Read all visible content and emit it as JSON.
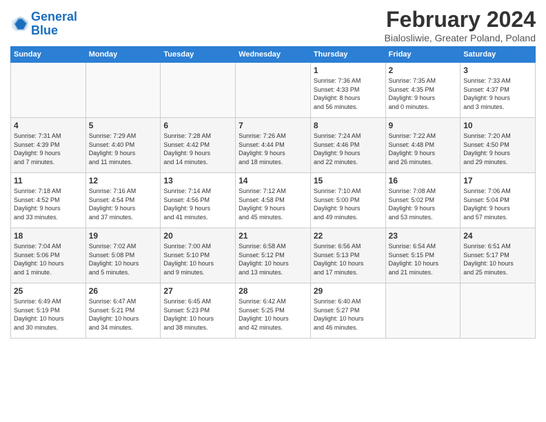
{
  "header": {
    "logo_line1": "General",
    "logo_line2": "Blue",
    "month_year": "February 2024",
    "location": "Bialosliwie, Greater Poland, Poland"
  },
  "days_of_week": [
    "Sunday",
    "Monday",
    "Tuesday",
    "Wednesday",
    "Thursday",
    "Friday",
    "Saturday"
  ],
  "weeks": [
    [
      {
        "day": "",
        "info": ""
      },
      {
        "day": "",
        "info": ""
      },
      {
        "day": "",
        "info": ""
      },
      {
        "day": "",
        "info": ""
      },
      {
        "day": "1",
        "info": "Sunrise: 7:36 AM\nSunset: 4:33 PM\nDaylight: 8 hours\nand 56 minutes."
      },
      {
        "day": "2",
        "info": "Sunrise: 7:35 AM\nSunset: 4:35 PM\nDaylight: 9 hours\nand 0 minutes."
      },
      {
        "day": "3",
        "info": "Sunrise: 7:33 AM\nSunset: 4:37 PM\nDaylight: 9 hours\nand 3 minutes."
      }
    ],
    [
      {
        "day": "4",
        "info": "Sunrise: 7:31 AM\nSunset: 4:39 PM\nDaylight: 9 hours\nand 7 minutes."
      },
      {
        "day": "5",
        "info": "Sunrise: 7:29 AM\nSunset: 4:40 PM\nDaylight: 9 hours\nand 11 minutes."
      },
      {
        "day": "6",
        "info": "Sunrise: 7:28 AM\nSunset: 4:42 PM\nDaylight: 9 hours\nand 14 minutes."
      },
      {
        "day": "7",
        "info": "Sunrise: 7:26 AM\nSunset: 4:44 PM\nDaylight: 9 hours\nand 18 minutes."
      },
      {
        "day": "8",
        "info": "Sunrise: 7:24 AM\nSunset: 4:46 PM\nDaylight: 9 hours\nand 22 minutes."
      },
      {
        "day": "9",
        "info": "Sunrise: 7:22 AM\nSunset: 4:48 PM\nDaylight: 9 hours\nand 26 minutes."
      },
      {
        "day": "10",
        "info": "Sunrise: 7:20 AM\nSunset: 4:50 PM\nDaylight: 9 hours\nand 29 minutes."
      }
    ],
    [
      {
        "day": "11",
        "info": "Sunrise: 7:18 AM\nSunset: 4:52 PM\nDaylight: 9 hours\nand 33 minutes."
      },
      {
        "day": "12",
        "info": "Sunrise: 7:16 AM\nSunset: 4:54 PM\nDaylight: 9 hours\nand 37 minutes."
      },
      {
        "day": "13",
        "info": "Sunrise: 7:14 AM\nSunset: 4:56 PM\nDaylight: 9 hours\nand 41 minutes."
      },
      {
        "day": "14",
        "info": "Sunrise: 7:12 AM\nSunset: 4:58 PM\nDaylight: 9 hours\nand 45 minutes."
      },
      {
        "day": "15",
        "info": "Sunrise: 7:10 AM\nSunset: 5:00 PM\nDaylight: 9 hours\nand 49 minutes."
      },
      {
        "day": "16",
        "info": "Sunrise: 7:08 AM\nSunset: 5:02 PM\nDaylight: 9 hours\nand 53 minutes."
      },
      {
        "day": "17",
        "info": "Sunrise: 7:06 AM\nSunset: 5:04 PM\nDaylight: 9 hours\nand 57 minutes."
      }
    ],
    [
      {
        "day": "18",
        "info": "Sunrise: 7:04 AM\nSunset: 5:06 PM\nDaylight: 10 hours\nand 1 minute."
      },
      {
        "day": "19",
        "info": "Sunrise: 7:02 AM\nSunset: 5:08 PM\nDaylight: 10 hours\nand 5 minutes."
      },
      {
        "day": "20",
        "info": "Sunrise: 7:00 AM\nSunset: 5:10 PM\nDaylight: 10 hours\nand 9 minutes."
      },
      {
        "day": "21",
        "info": "Sunrise: 6:58 AM\nSunset: 5:12 PM\nDaylight: 10 hours\nand 13 minutes."
      },
      {
        "day": "22",
        "info": "Sunrise: 6:56 AM\nSunset: 5:13 PM\nDaylight: 10 hours\nand 17 minutes."
      },
      {
        "day": "23",
        "info": "Sunrise: 6:54 AM\nSunset: 5:15 PM\nDaylight: 10 hours\nand 21 minutes."
      },
      {
        "day": "24",
        "info": "Sunrise: 6:51 AM\nSunset: 5:17 PM\nDaylight: 10 hours\nand 25 minutes."
      }
    ],
    [
      {
        "day": "25",
        "info": "Sunrise: 6:49 AM\nSunset: 5:19 PM\nDaylight: 10 hours\nand 30 minutes."
      },
      {
        "day": "26",
        "info": "Sunrise: 6:47 AM\nSunset: 5:21 PM\nDaylight: 10 hours\nand 34 minutes."
      },
      {
        "day": "27",
        "info": "Sunrise: 6:45 AM\nSunset: 5:23 PM\nDaylight: 10 hours\nand 38 minutes."
      },
      {
        "day": "28",
        "info": "Sunrise: 6:42 AM\nSunset: 5:25 PM\nDaylight: 10 hours\nand 42 minutes."
      },
      {
        "day": "29",
        "info": "Sunrise: 6:40 AM\nSunset: 5:27 PM\nDaylight: 10 hours\nand 46 minutes."
      },
      {
        "day": "",
        "info": ""
      },
      {
        "day": "",
        "info": ""
      }
    ]
  ]
}
